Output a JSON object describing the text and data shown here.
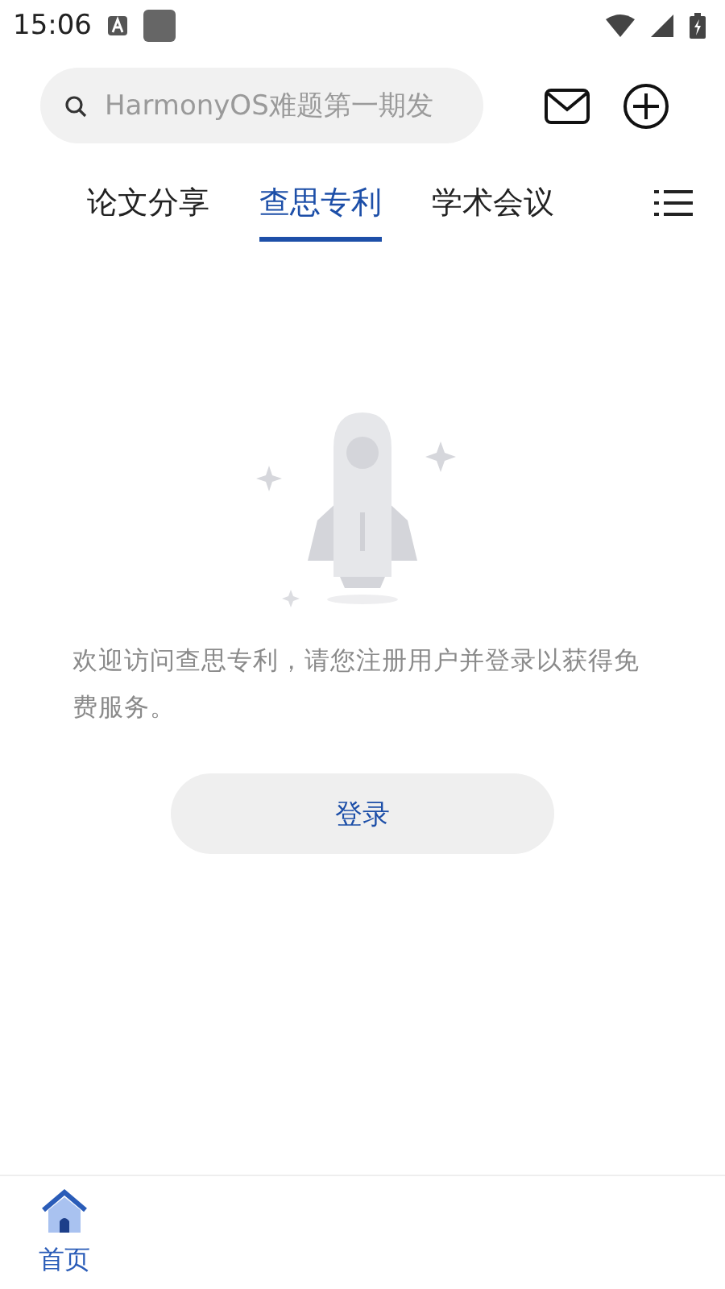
{
  "status_bar": {
    "time": "15:06"
  },
  "search": {
    "placeholder": "HarmonyOS难题第一期发"
  },
  "tabs": [
    {
      "label": "论文分享",
      "selected": false
    },
    {
      "label": "查思专利",
      "selected": true
    },
    {
      "label": "学术会议",
      "selected": false
    }
  ],
  "empty_state": {
    "message": "欢迎访问查思专利，请您注册用户并登录以获得免费服务。",
    "button": "登录"
  },
  "bottom_nav": [
    {
      "label": "首页",
      "selected": true
    }
  ]
}
